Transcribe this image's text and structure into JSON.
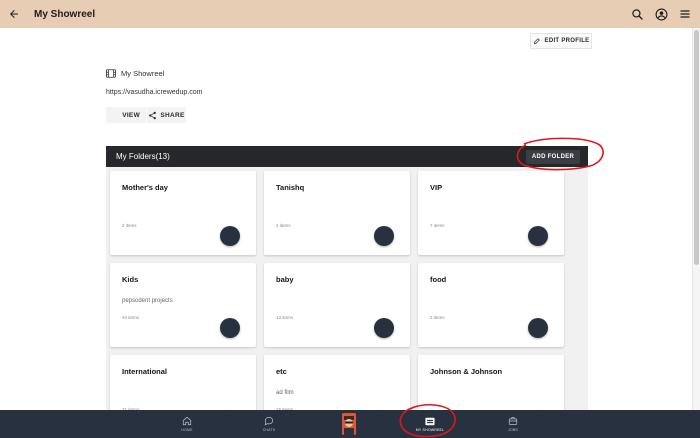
{
  "appbar": {
    "title": "My Showreel",
    "icons": [
      "back-arrow-icon",
      "search-icon",
      "account-icon",
      "menu-icon"
    ]
  },
  "profile": {
    "edit_label": "EDIT PROFILE",
    "showreel_label": "My Showreel",
    "url": "https://vasudha.icrewedup.com",
    "view_label": "VIEW",
    "share_label": "SHARE"
  },
  "folders": {
    "title": "My Folders(13)",
    "add_label": "ADD FOLDER",
    "items": [
      {
        "name": "Mother's day",
        "desc": "",
        "count": "2 items"
      },
      {
        "name": "Tanishq",
        "desc": "",
        "count": "2 items"
      },
      {
        "name": "VIP",
        "desc": "",
        "count": "7 items"
      },
      {
        "name": "Kids",
        "desc": "pepsodent projects",
        "count": "10 items"
      },
      {
        "name": "baby",
        "desc": "",
        "count": "13 items"
      },
      {
        "name": "food",
        "desc": "",
        "count": "2 items"
      },
      {
        "name": "International",
        "desc": "",
        "count": "21 items"
      },
      {
        "name": "etc",
        "desc": "ad film",
        "count": "15 items"
      },
      {
        "name": "Johnson & Johnson",
        "desc": "",
        "count": ""
      }
    ]
  },
  "bottom_nav": {
    "items": [
      {
        "label": "HOME",
        "icon": "home-icon"
      },
      {
        "label": "CHATS",
        "icon": "chat-icon"
      },
      {
        "label": "",
        "icon": "avatar"
      },
      {
        "label": "MY SHOWREEL",
        "icon": "film-icon",
        "active": true
      },
      {
        "label": "JOBS",
        "icon": "briefcase-icon"
      }
    ]
  },
  "colors": {
    "appbar": "#e8cdb5",
    "dark": "#27313f",
    "annotation": "#e0161b"
  }
}
